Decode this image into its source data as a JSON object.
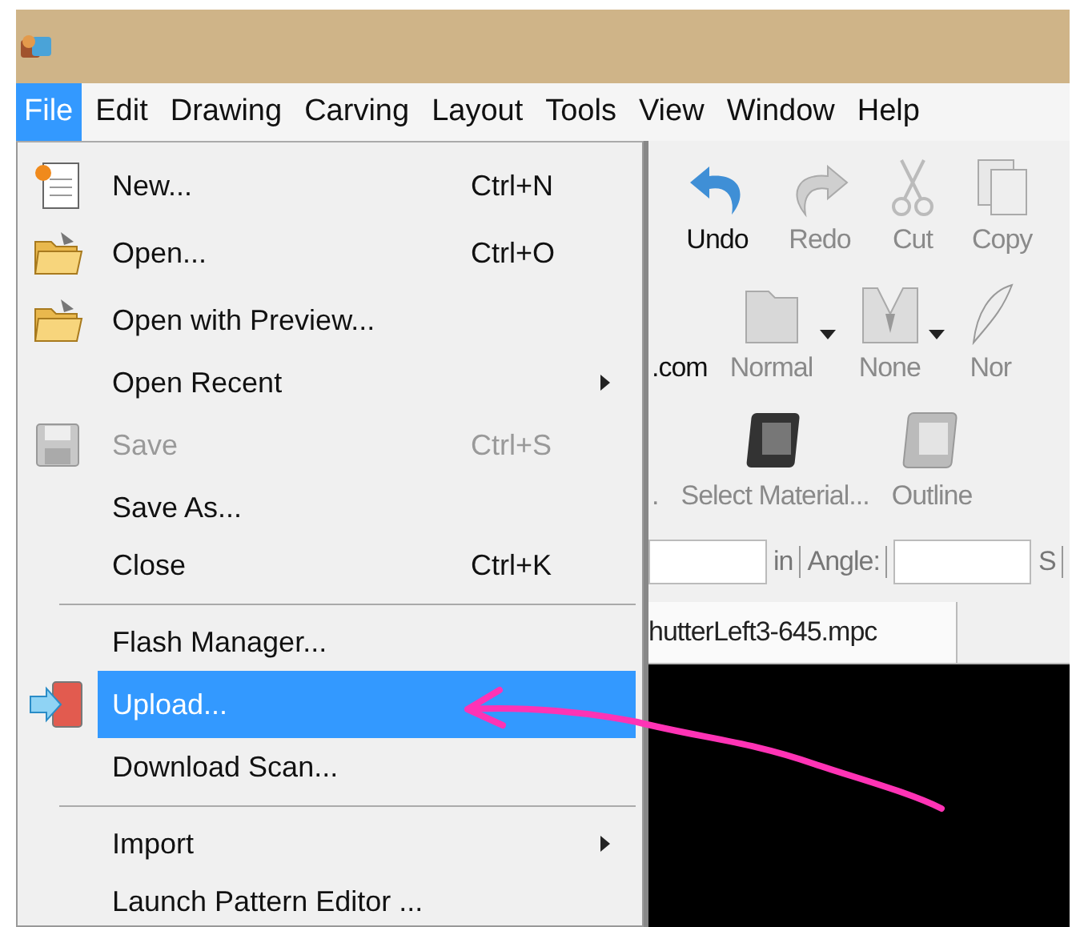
{
  "menu_bar": [
    {
      "label": "File",
      "selected": true
    },
    {
      "label": "Edit",
      "selected": false
    },
    {
      "label": "Drawing",
      "selected": false
    },
    {
      "label": "Carving",
      "selected": false
    },
    {
      "label": "Layout",
      "selected": false
    },
    {
      "label": "Tools",
      "selected": false
    },
    {
      "label": "View",
      "selected": false
    },
    {
      "label": "Window",
      "selected": false
    },
    {
      "label": "Help",
      "selected": false
    }
  ],
  "file_menu": [
    {
      "kind": "new",
      "label": "New...",
      "shortcut": "Ctrl+N",
      "disabled": false,
      "selected": false,
      "submenu": false
    },
    {
      "kind": "open",
      "label": "Open...",
      "shortcut": "Ctrl+O",
      "disabled": false,
      "selected": false,
      "submenu": false
    },
    {
      "kind": "open",
      "label": "Open with Preview...",
      "disabled": false,
      "selected": false,
      "submenu": false
    },
    {
      "kind": "plain",
      "label": "Open Recent",
      "disabled": false,
      "selected": false,
      "submenu": true
    },
    {
      "kind": "save",
      "label": "Save",
      "shortcut": "Ctrl+S",
      "disabled": true,
      "selected": false,
      "submenu": false
    },
    {
      "kind": "plain",
      "label": "Save As...",
      "disabled": false,
      "selected": false,
      "submenu": false
    },
    {
      "kind": "plain",
      "label": "Close",
      "shortcut": "Ctrl+K",
      "disabled": false,
      "selected": false,
      "submenu": false
    },
    {
      "kind": "separator"
    },
    {
      "kind": "plain",
      "label": "Flash Manager...",
      "disabled": false,
      "selected": false,
      "submenu": false
    },
    {
      "kind": "upload",
      "label": "Upload...",
      "disabled": false,
      "selected": true,
      "submenu": false
    },
    {
      "kind": "plain",
      "label": "Download Scan...",
      "disabled": false,
      "selected": false,
      "submenu": false
    },
    {
      "kind": "separator"
    },
    {
      "kind": "plain",
      "label": "Import",
      "disabled": false,
      "selected": false,
      "submenu": true
    },
    {
      "kind": "plain",
      "label": "Launch Pattern Editor ...",
      "disabled": false,
      "selected": false,
      "submenu": false
    }
  ],
  "toolbar_rows": [
    [
      {
        "kind": "undo",
        "label": "Undo",
        "disabled": false
      },
      {
        "kind": "redo",
        "label": "Redo",
        "disabled": true
      },
      {
        "kind": "cut",
        "label": "Cut",
        "disabled": true
      },
      {
        "kind": "copy",
        "label": "Copy",
        "disabled": true
      }
    ],
    [
      {
        "kind": "text",
        "label": ".com",
        "disabled": false
      },
      {
        "kind": "folder",
        "label": "Normal",
        "disabled": true,
        "dropdown": true
      },
      {
        "kind": "shape",
        "label": "None",
        "disabled": true,
        "dropdown": true
      },
      {
        "kind": "feather",
        "label": "Nor",
        "disabled": true
      }
    ],
    [
      {
        "kind": "text",
        "label": ".",
        "disabled": true
      },
      {
        "kind": "material",
        "label": "Select Material...",
        "disabled": true
      },
      {
        "kind": "outline",
        "label": "Outline",
        "disabled": true
      }
    ]
  ],
  "size_bar": {
    "unit": "in",
    "angle_label": "Angle:",
    "next_label": "S"
  },
  "tabs": [
    {
      "label": "hutterLeft3-645.mpc",
      "selected": true
    }
  ]
}
